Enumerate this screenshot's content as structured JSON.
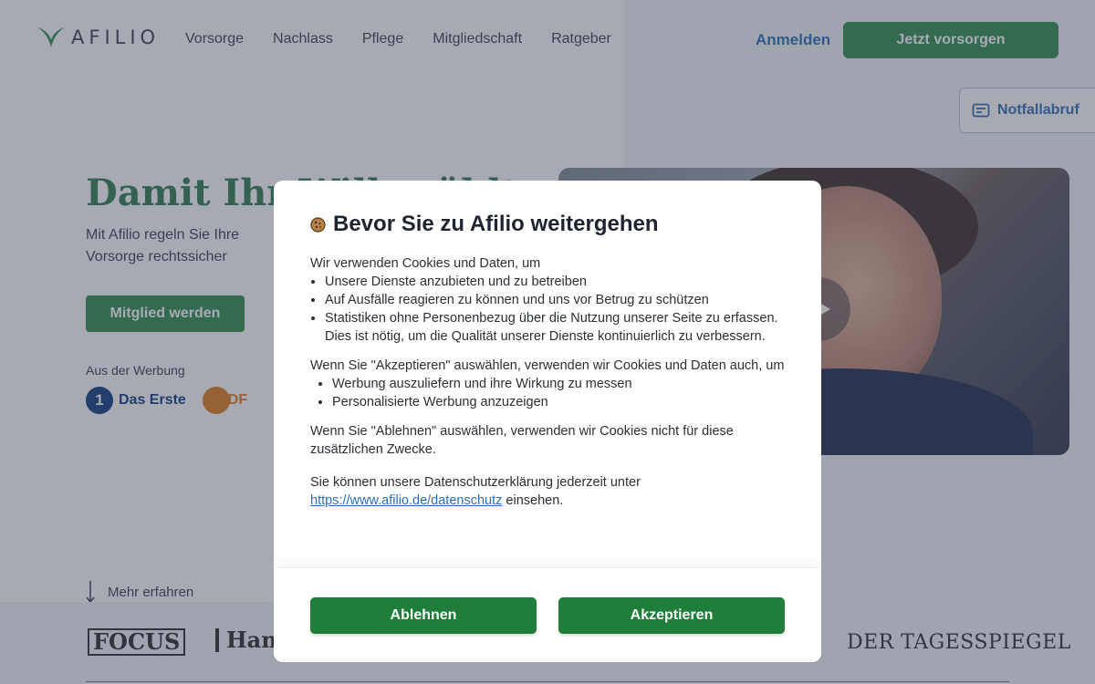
{
  "header": {
    "logo_text": "AFILIO",
    "nav": [
      "Vorsorge",
      "Nachlass",
      "Pflege",
      "Mitgliedschaft",
      "Ratgeber"
    ],
    "login_label": "Anmelden",
    "cta_label": "Jetzt vorsorgen",
    "emergency_label": "Notfallabruf"
  },
  "hero": {
    "title": "Damit Ihr Wille zählt",
    "subtitle": "Mit Afilio regeln Sie Ihre Vorsorge rechtssicher",
    "button_label": "Mitglied werden",
    "ad_label": "Aus der Werbung",
    "tv_logos": [
      "Das Erste",
      "ZDF"
    ]
  },
  "more_label": "Mehr erfahren",
  "press": [
    "FOCUS",
    "Han",
    "DER TAGESSPIEGEL"
  ],
  "modal": {
    "title": "Bevor Sie zu Afilio weitergehen",
    "intro": "Wir verwenden Cookies und Daten, um",
    "purposes": [
      "Unsere Dienste anzubieten und zu betreiben",
      "Auf Ausfälle reagieren zu können und uns vor Betrug zu schützen",
      "Statistiken ohne Personenbezug über die Nutzung unserer Seite zu erfassen. Dies ist nötig, um die Qualität unserer Dienste kontinuierlich zu verbessern."
    ],
    "accept_intro": "Wenn Sie \"Akzeptieren\" auswählen, verwenden wir Cookies und Daten auch, um",
    "accept_purposes": [
      "Werbung auszuliefern und ihre Wirkung zu messen",
      "Personalisierte Werbung anzuzeigen"
    ],
    "decline_text": "Wenn Sie \"Ablehnen\" auswählen, verwenden wir Cookies nicht für diese zusätzlichen Zwecke.",
    "privacy_prefix": "Sie können unsere Datenschutzerklärung jederzeit unter",
    "privacy_link": "https://www.afilio.de/datenschutz",
    "privacy_suffix": "einsehen.",
    "decline_label": "Ablehnen",
    "accept_label": "Akzeptieren"
  },
  "colors": {
    "brand_green": "#2f8a4c",
    "button_green": "#1e7e3a",
    "link_blue": "#2d6db5",
    "overlay": "rgba(60,66,86,0.45)"
  }
}
